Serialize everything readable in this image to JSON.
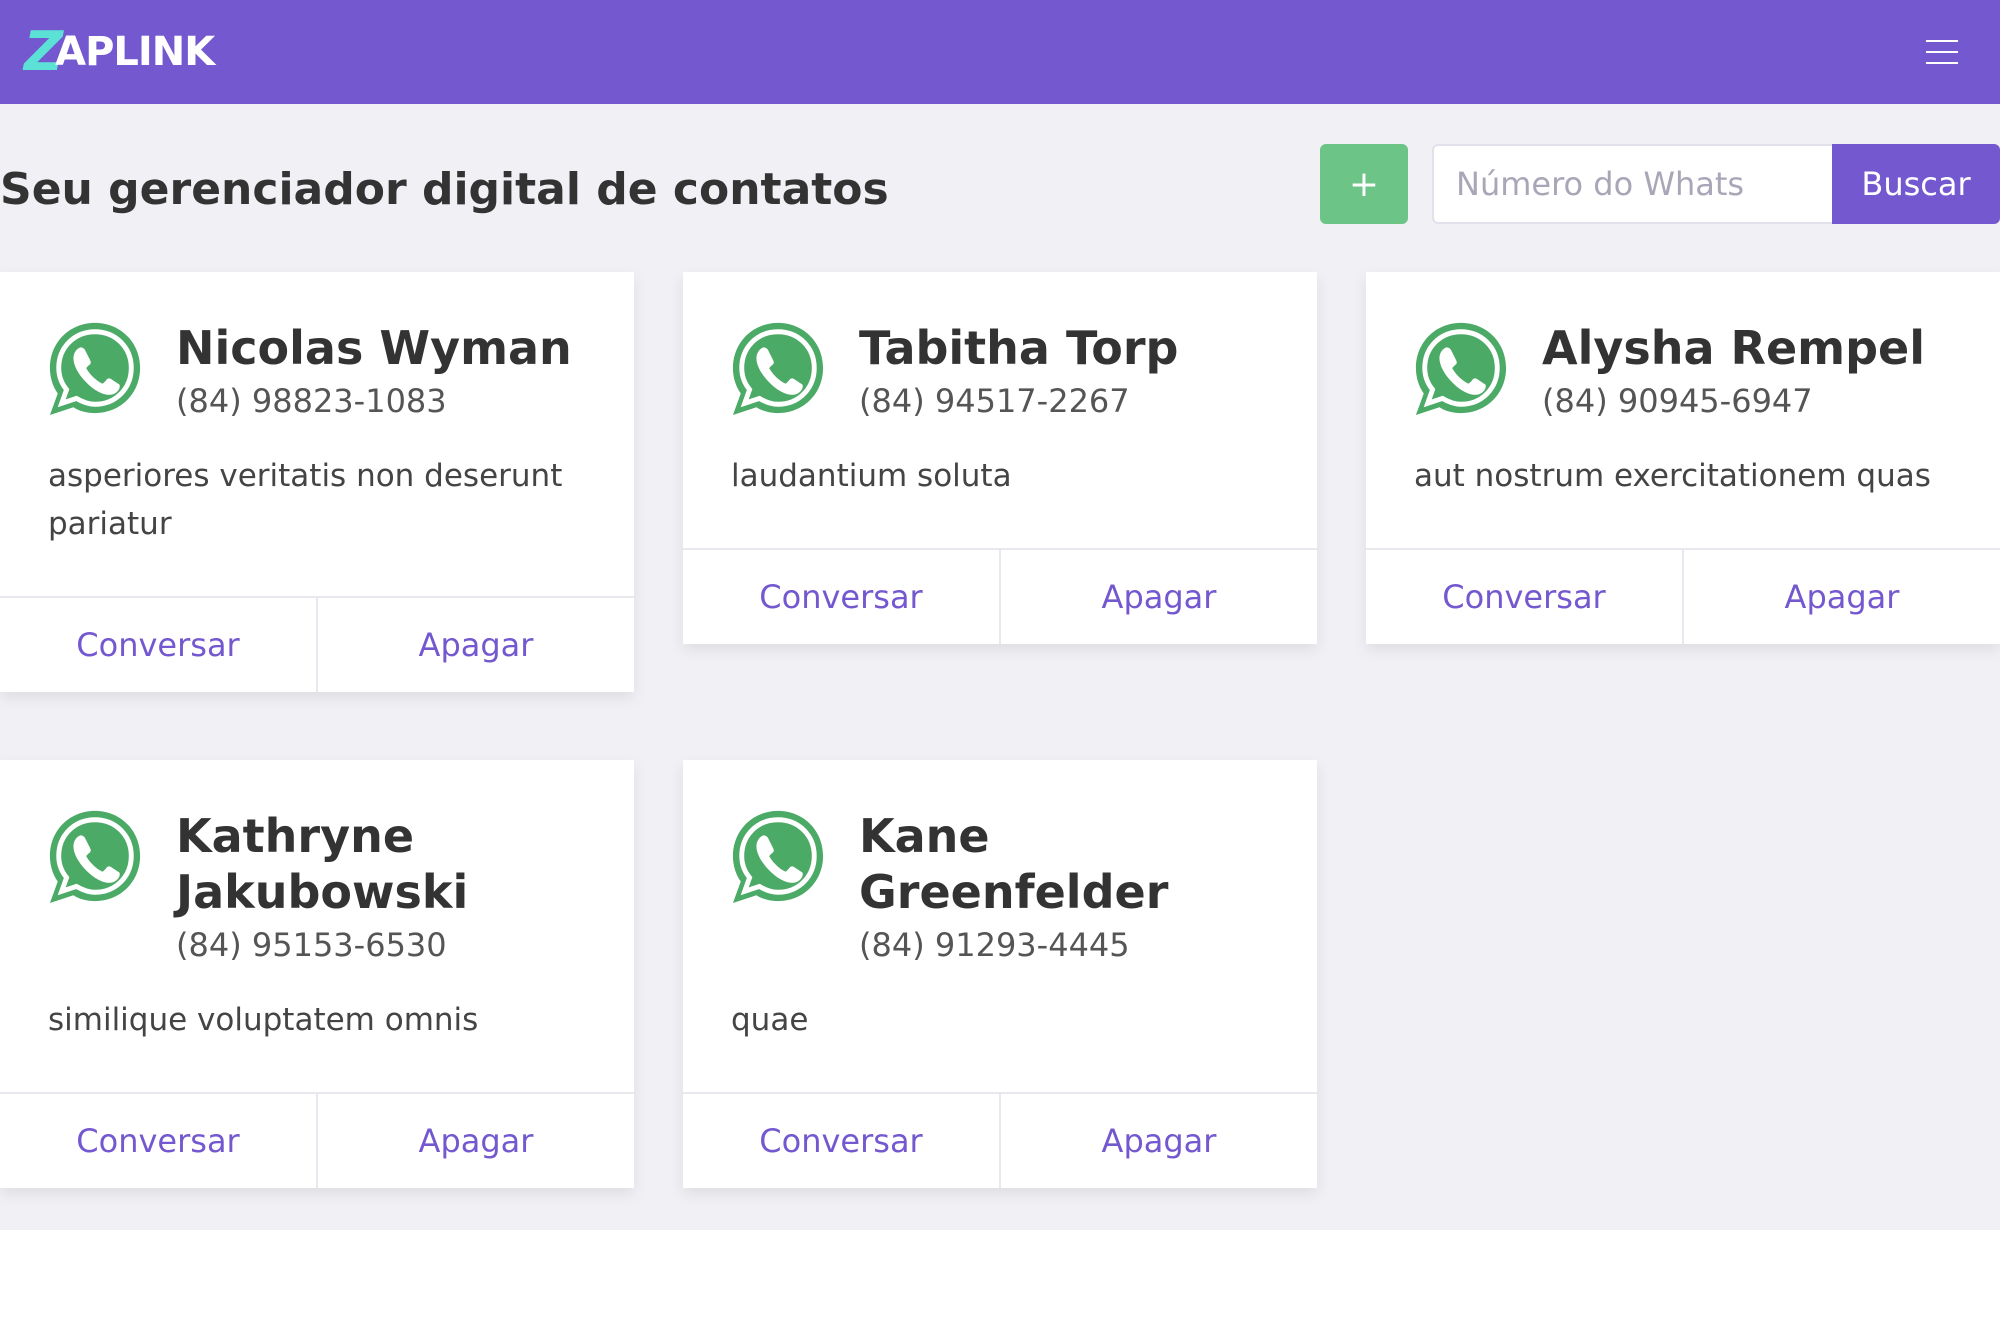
{
  "brand": {
    "logo_z": "Z",
    "logo_rest": "APLINK",
    "colors": {
      "primary": "#7458cf",
      "accent": "#5ce1d6",
      "success": "#6cc487",
      "whatsapp": "#4caa67"
    }
  },
  "navbar": {
    "menu_icon": "hamburger-icon"
  },
  "header": {
    "title": "Seu gerenciador digital de contatos",
    "add_label": "+",
    "search_placeholder": "Número do Whats",
    "search_label": "Buscar"
  },
  "contacts": [
    {
      "name": "Nicolas Wyman",
      "phone": "(84) 98823-1083",
      "note": "asperiores veritatis non deserunt pariatur",
      "chat_label": "Conversar",
      "delete_label": "Apagar"
    },
    {
      "name": "Tabitha Torp",
      "phone": "(84) 94517-2267",
      "note": "laudantium soluta",
      "chat_label": "Conversar",
      "delete_label": "Apagar"
    },
    {
      "name": "Alysha Rempel",
      "phone": "(84) 90945-6947",
      "note": "aut nostrum exercitationem quas",
      "chat_label": "Conversar",
      "delete_label": "Apagar"
    },
    {
      "name": "Kathryne Jakubowski",
      "phone": "(84) 95153-6530",
      "note": "similique voluptatem omnis",
      "chat_label": "Conversar",
      "delete_label": "Apagar"
    },
    {
      "name": "Kane Greenfelder",
      "phone": "(84) 91293-4445",
      "note": "quae",
      "chat_label": "Conversar",
      "delete_label": "Apagar"
    }
  ]
}
